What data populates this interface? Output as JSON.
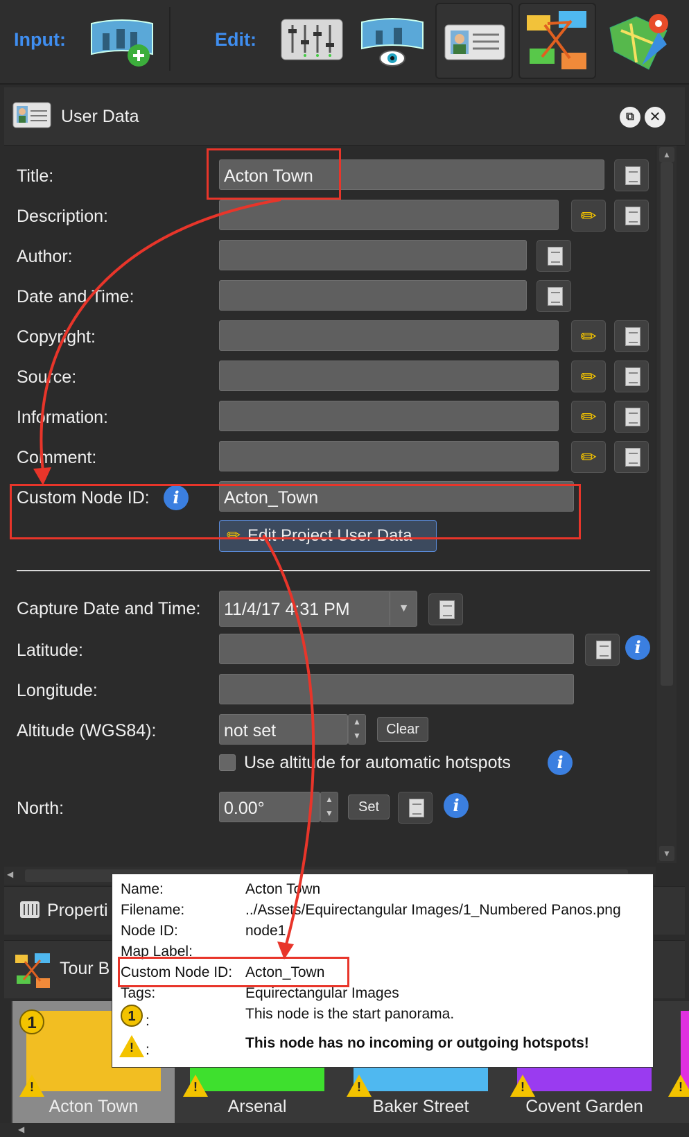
{
  "toolbar": {
    "input_label": "Input:",
    "edit_label": "Edit:"
  },
  "panel": {
    "title": "User Data"
  },
  "fields": {
    "title_label": "Title:",
    "title_value": "Acton Town",
    "description_label": "Description:",
    "author_label": "Author:",
    "datetime_label": "Date and Time:",
    "copyright_label": "Copyright:",
    "source_label": "Source:",
    "information_label": "Information:",
    "comment_label": "Comment:",
    "custom_node_label": "Custom Node ID:",
    "custom_node_value": "Acton_Town",
    "edit_project_button": "Edit Project User Data",
    "capture_label": "Capture Date and Time:",
    "capture_value": "11/4/17 4:31 PM",
    "latitude_label": "Latitude:",
    "longitude_label": "Longitude:",
    "altitude_label": "Altitude (WGS84):",
    "altitude_value": "not set",
    "clear_button": "Clear",
    "use_altitude_label": "Use altitude for automatic hotspots",
    "north_label": "North:",
    "north_value": "0.00°",
    "set_button": "Set"
  },
  "sections": {
    "properties": "Properti",
    "tour": "Tour B"
  },
  "tooltip": {
    "name_key": "Name:",
    "name_val": "Acton Town",
    "filename_key": "Filename:",
    "filename_val": "../Assets/Equirectangular Images/1_Numbered Panos.png",
    "nodeid_key": "Node ID:",
    "nodeid_val": "node1",
    "maplabel_key": "Map Label:",
    "custom_key": "Custom Node ID:",
    "custom_val": "Acton_Town",
    "tags_key": "Tags:",
    "tags_val": "Equirectangular Images",
    "start_colon": ":",
    "start_msg": "This node is the start panorama.",
    "warn_colon": ":",
    "warn_msg": "This node has no incoming or outgoing hotspots!"
  },
  "tour_nodes": [
    {
      "name": "Acton Town",
      "color": "#f2be22"
    },
    {
      "name": "Arsenal",
      "color": "#3ee02e"
    },
    {
      "name": "Baker Street",
      "color": "#4fb8f0"
    },
    {
      "name": "Covent Garden",
      "color": "#9a3bf0"
    }
  ],
  "colors": {
    "accent_blue": "#3f8ef0",
    "highlight_red": "#e8352a"
  }
}
